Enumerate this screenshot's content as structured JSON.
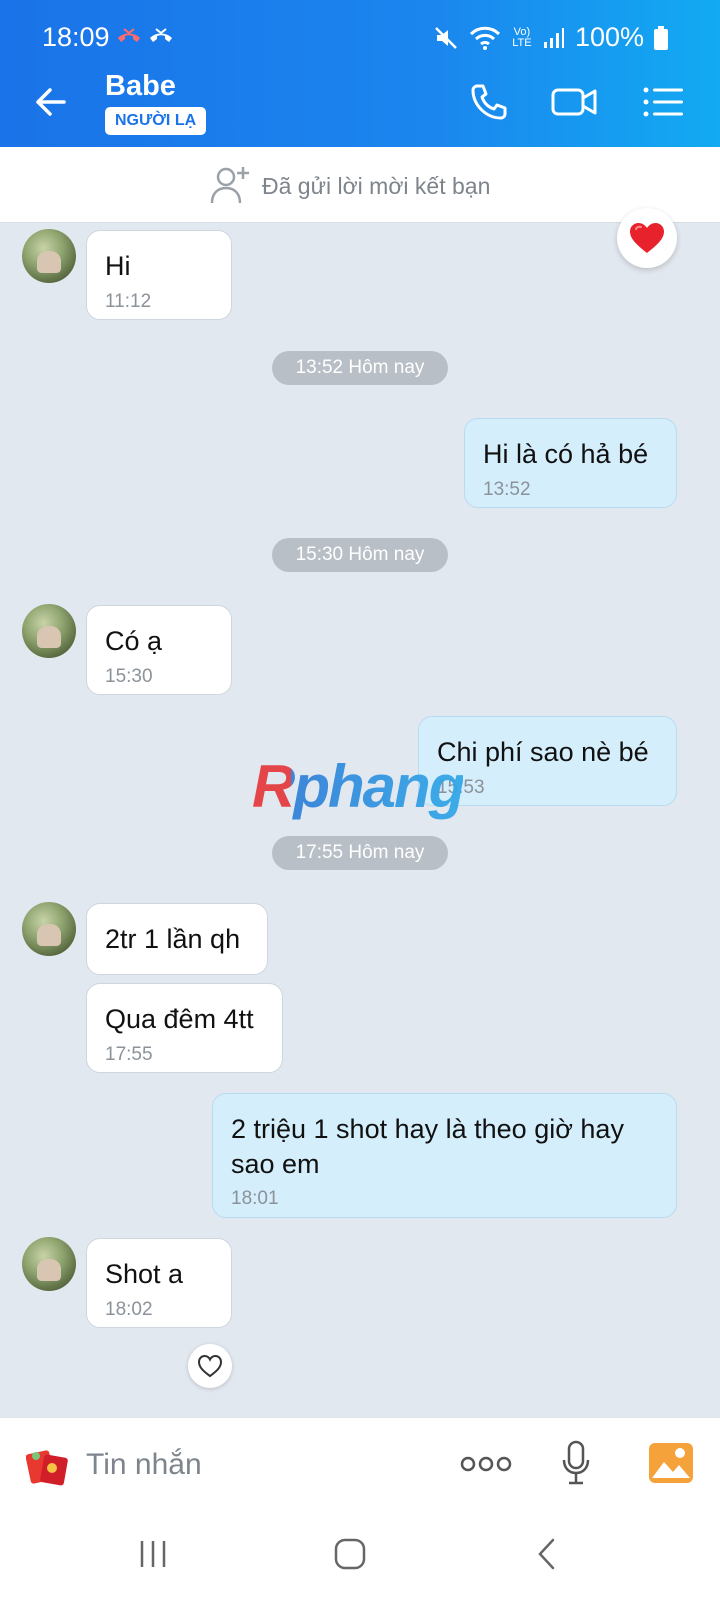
{
  "status": {
    "time": "18:09",
    "lte": "Vo) LTE",
    "battery": "100%"
  },
  "header": {
    "name": "Babe",
    "badge": "NGƯỜI LẠ"
  },
  "friend_request": {
    "text": "Đã gửi lời mời kết bạn"
  },
  "messages": [
    {
      "dir": "in",
      "text": "Hi",
      "time": "11:12"
    },
    {
      "dir": "out",
      "text": "Hi là có hả bé",
      "time": "13:52"
    },
    {
      "dir": "in",
      "text": "Có ạ",
      "time": "15:30"
    },
    {
      "dir": "out",
      "text": "Chi phí sao nè bé",
      "time": "15:53"
    },
    {
      "dir": "in",
      "text": "2tr 1 lần qh",
      "time": ""
    },
    {
      "dir": "in",
      "text": "Qua đêm 4tt",
      "time": "17:55"
    },
    {
      "dir": "out",
      "text": "2 triệu 1 shot hay là theo giờ hay sao em",
      "time": "18:01"
    },
    {
      "dir": "in",
      "text": "Shot a",
      "time": "18:02"
    }
  ],
  "separators": [
    "13:52 Hôm nay",
    "15:30 Hôm nay",
    "17:55 Hôm nay"
  ],
  "watermark": "Rphang",
  "composer": {
    "placeholder": "Tin nhắn"
  },
  "colors": {
    "accent": "#1a73e8",
    "incoming": "#ffffff",
    "outgoing": "#d5eefc",
    "background": "#e2e8ef"
  },
  "icons": [
    "back-arrow-icon",
    "phone-icon",
    "video-call-icon",
    "menu-list-icon",
    "add-friend-icon",
    "heart-icon",
    "sticker-icon",
    "more-icon",
    "mic-icon",
    "image-icon",
    "recent-apps-icon",
    "home-icon",
    "nav-back-icon"
  ]
}
